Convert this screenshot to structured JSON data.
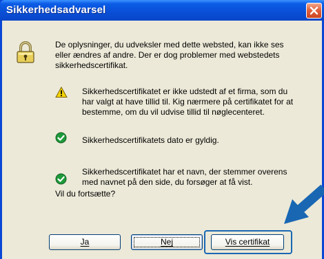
{
  "dialog": {
    "title": "Sikkerhedsadvarsel",
    "intro": "De oplysninger, du udveksler med dette websted, kan ikke ses\neller ændres af andre. Der er dog problemer med webstedets\nsikkerhedscertifikat.",
    "items": [
      {
        "icon": "warning-icon",
        "text": "Sikkerhedscertifikatet er ikke udstedt af et firma, som du\nhar valgt at have tillid til. Kig nærmere på certifikatet for at\nbestemme, om du vil udvise tillid til nøglecenteret."
      },
      {
        "icon": "check-icon",
        "text": "Sikkerhedscertifikatets dato er gyldig."
      },
      {
        "icon": "check-icon",
        "text": "Sikkerhedscertifikatet har et navn, der stemmer overens\nmed navnet på den side, du forsøger at få vist."
      }
    ],
    "question": "Vil du fortsætte?",
    "buttons": {
      "yes": "Ja",
      "no": "Nej",
      "view_cert": "Vis certifikat"
    }
  },
  "colors": {
    "titlebar": "#0a50d8",
    "client": "#ece9d8",
    "arrow": "#1967b3",
    "warning": "#f5d300",
    "check": "#1e9a3a"
  }
}
